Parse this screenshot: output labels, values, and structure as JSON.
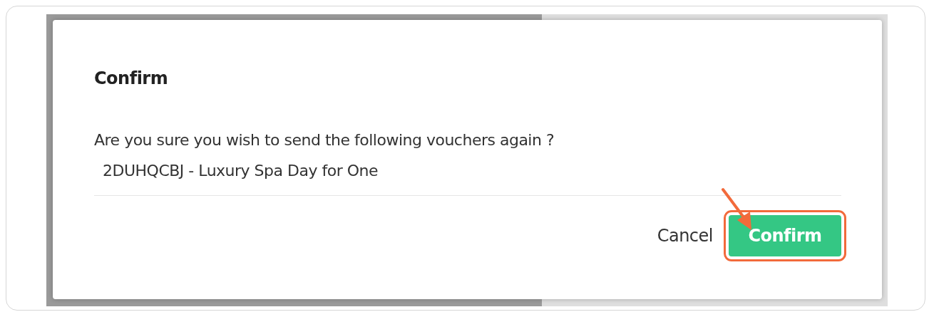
{
  "dialog": {
    "title": "Confirm",
    "message": "Are you sure you wish to send the following vouchers again ?",
    "vouchers": [
      "2DUHQCBJ - Luxury Spa Day for One"
    ],
    "buttons": [
      {
        "label": "Cancel",
        "kind": "link",
        "highlighted": false
      },
      {
        "label": "Confirm",
        "kind": "primary",
        "highlighted": true
      }
    ]
  }
}
